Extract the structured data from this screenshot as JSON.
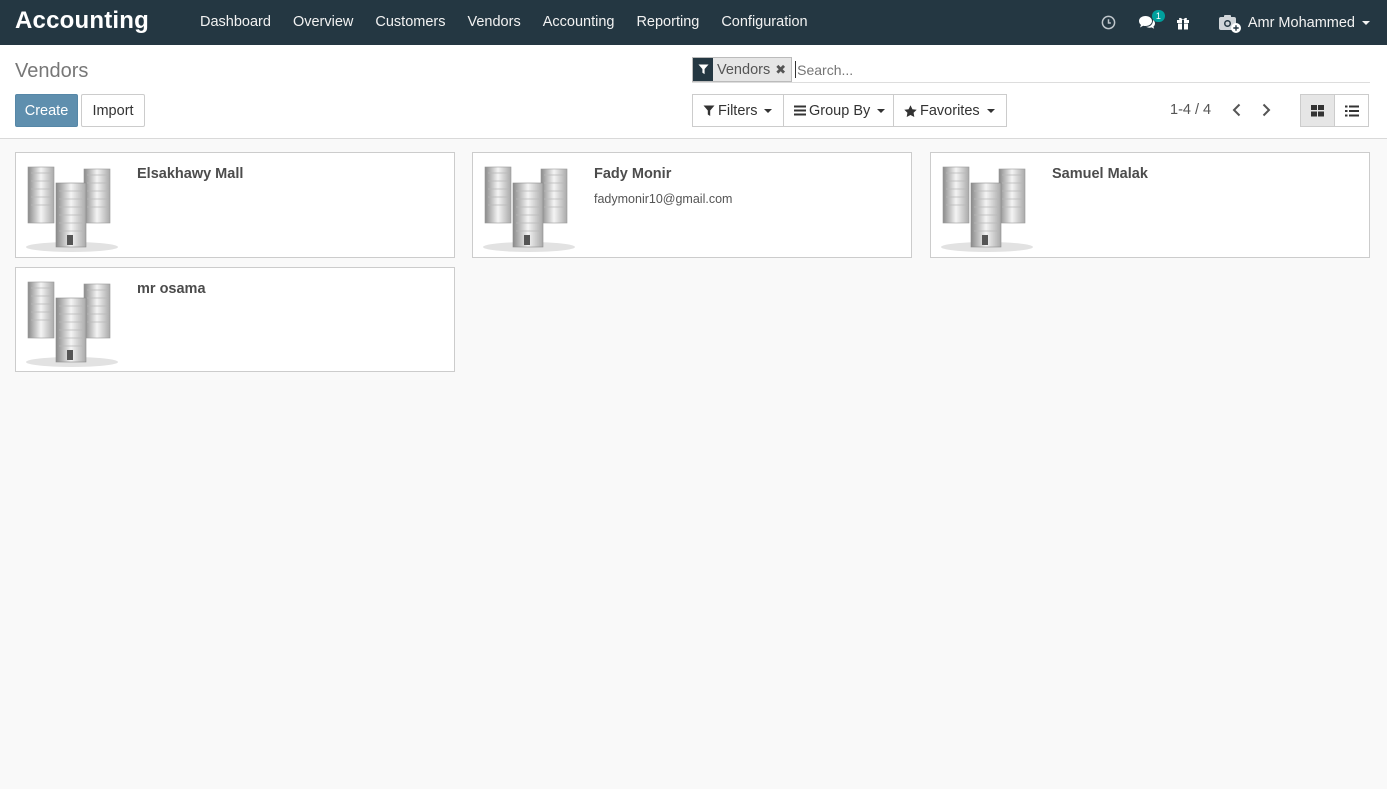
{
  "app": {
    "title": "Accounting"
  },
  "menu": [
    {
      "label": "Dashboard"
    },
    {
      "label": "Overview"
    },
    {
      "label": "Customers"
    },
    {
      "label": "Vendors"
    },
    {
      "label": "Accounting"
    },
    {
      "label": "Reporting"
    },
    {
      "label": "Configuration"
    }
  ],
  "systray": {
    "messages_count": "1",
    "user_name": "Amr Mohammed"
  },
  "page": {
    "title": "Vendors"
  },
  "buttons": {
    "create": "Create",
    "import": "Import"
  },
  "search": {
    "facet": "Vendors",
    "facet_remove": "✖",
    "placeholder": "Search..."
  },
  "options": {
    "filters": "Filters",
    "group_by": "Group By",
    "favorites": "Favorites"
  },
  "pager": {
    "value": "1-4 / 4"
  },
  "cards": [
    {
      "name": "Elsakhawy Mall",
      "email": ""
    },
    {
      "name": "Fady Monir",
      "email": "fadymonir10@gmail.com"
    },
    {
      "name": "Samuel Malak",
      "email": ""
    },
    {
      "name": "mr osama",
      "email": ""
    }
  ],
  "colors": {
    "navbar": "#243742",
    "primary": "#5f8fae",
    "badge": "#00a09d",
    "background": "#f9f9f9"
  }
}
